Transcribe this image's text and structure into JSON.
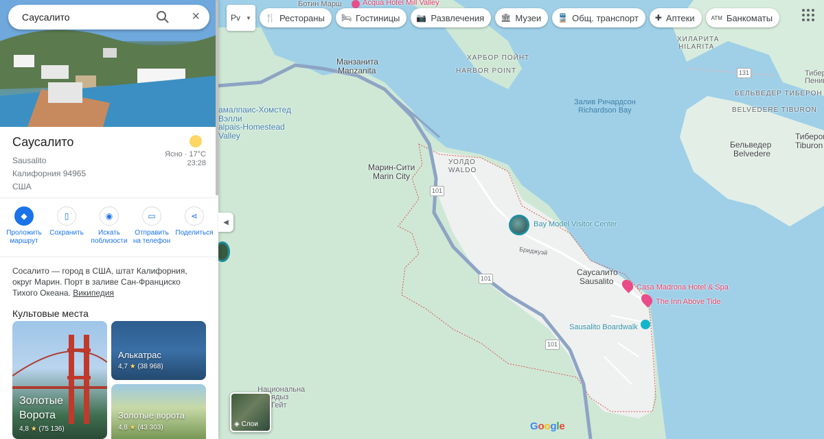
{
  "search": {
    "value": "Саусалито"
  },
  "place": {
    "name": "Саусалито",
    "latin_name": "Sausalito",
    "region": "Калифорния 94965",
    "country": "США",
    "weather": {
      "condition_temp": "Ясно · 17°C",
      "time": "23:28"
    }
  },
  "actions": [
    {
      "label": "Проложить маршрут",
      "icon": "directions-icon"
    },
    {
      "label": "Сохранить",
      "icon": "bookmark-icon"
    },
    {
      "label": "Искать поблизости",
      "icon": "nearby-icon"
    },
    {
      "label": "Отправить на телефон",
      "icon": "send-to-phone-icon"
    },
    {
      "label": "Поделиться",
      "icon": "share-icon"
    }
  ],
  "description": {
    "text": "Сосалито — город в США, штат Калифорния, округ Марин. Порт в заливе Сан-Франциско Тихого Океана.",
    "link": "Википедия"
  },
  "landmarks": {
    "title": "Культовые места",
    "items": [
      {
        "name": "Золотые Ворота",
        "rating": "4,8",
        "reviews": "(75 136)"
      },
      {
        "name": "Алькатрас",
        "rating": "4,7",
        "reviews": "(38 968)"
      },
      {
        "name": "Золотые ворота",
        "rating": "4,8",
        "reviews": "(43 303)"
      }
    ]
  },
  "chips": {
    "first": "Рv",
    "items": [
      {
        "label": "Рестораны",
        "icon": "restaurant-icon"
      },
      {
        "label": "Гостиницы",
        "icon": "hotel-icon"
      },
      {
        "label": "Развлечения",
        "icon": "camera-icon"
      },
      {
        "label": "Музеи",
        "icon": "museum-icon"
      },
      {
        "label": "Общ. транспорт",
        "icon": "transit-icon"
      },
      {
        "label": "Аптеки",
        "icon": "pharmacy-icon"
      },
      {
        "label": "Банкоматы",
        "icon": "atm-icon"
      }
    ]
  },
  "map": {
    "labels": {
      "botin": "Ботин Марш",
      "acqua": "Acqua Hotel Mill Valley",
      "manzanita_ru": "Манзанита",
      "manzanita_en": "Manzanita",
      "harbor_ru": "ХАРБОР ПОЙНТ",
      "harbor_en": "HARBOR POINT",
      "richardson_ru": "Залив Ричардсон",
      "richardson_en": "Richardson Bay",
      "homestead_ru": "амалпаис-Хомстед Вэлли",
      "homestead_en": "alpais-Homestead Valley",
      "marin_ru": "Марин-Сити",
      "marin_en": "Marin City",
      "waldo_ru": "УОЛДО",
      "waldo_en": "WALDO",
      "bay_model": "Bay Model Visitor Center",
      "bridgeway": "Бриджуэй",
      "sausalito_ru": "Саусалито",
      "sausalito_en": "Sausalito",
      "casa_madrona": "Casa Madrona Hotel & Spa",
      "inn": "The Inn Above Tide",
      "boardwalk": "Sausalito Boardwalk",
      "belvedere_ru": "Бельведер",
      "belvedere_en": "Belvedere",
      "belv_tib_ru": "БЕЛЬВЕДЕР ТИБЕРОН",
      "belv_tib_en": "BELVEDERE TIBURON",
      "hilarita_ru": "ХИЛАРИТА",
      "hilarita_en": "HILARITA",
      "tiburon_ru": "Тиберон",
      "tiburon_en": "Tiburon",
      "tib_pen_ru": "Тибер",
      "tib_pen_en": "Пенин",
      "national_ru": "Национальна",
      "national_2": "ядыз",
      "national_3": "Гейт",
      "hwy_101": "101",
      "hwy_131": "131",
      "layers": "Слои",
      "google": "Google"
    },
    "colors": {
      "water": "#9fd0e8",
      "land": "#cfe8d6",
      "town": "#f1f3f4",
      "boundary": "#d9534f",
      "highway": "#8ea4c4"
    }
  }
}
